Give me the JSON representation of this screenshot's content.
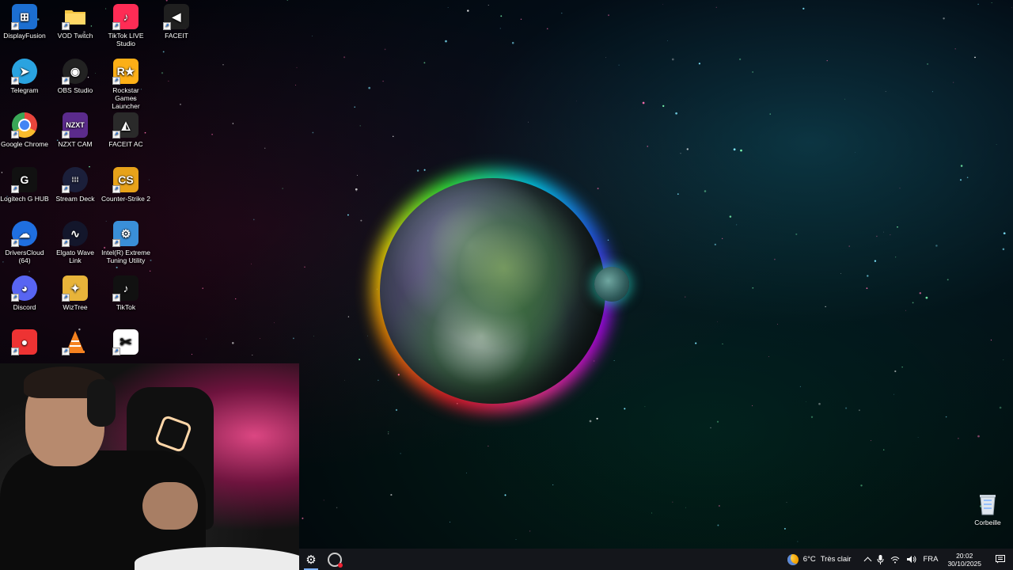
{
  "desktop": {
    "icons": [
      {
        "label": "DisplayFusion",
        "icon": "displayfusion-icon",
        "color": "#1c6fd1",
        "glyph": "⊞"
      },
      {
        "label": "VOD Twitch",
        "icon": "folder-icon",
        "color": "#f4c542",
        "glyph": ""
      },
      {
        "label": "TikTok LIVE Studio",
        "icon": "tiktok-live-studio-icon",
        "color": "#fe2c55",
        "glyph": "♪"
      },
      {
        "label": "FACEIT",
        "icon": "faceit-icon",
        "color": "#1f1f1f",
        "glyph": "◀"
      },
      {
        "label": "Telegram",
        "icon": "telegram-icon",
        "color": "#2aa3e0",
        "glyph": "➤"
      },
      {
        "label": "OBS Studio",
        "icon": "obs-studio-icon",
        "color": "#222222",
        "glyph": "◉"
      },
      {
        "label": "Rockstar Games Launcher",
        "icon": "rockstar-games-icon",
        "color": "#fcaf17",
        "glyph": "R★"
      },
      {
        "label": "Google Chrome",
        "icon": "chrome-icon",
        "color": "#e8453c",
        "glyph": "●"
      },
      {
        "label": "NZXT CAM",
        "icon": "nzxt-cam-icon",
        "color": "#5b2b8c",
        "glyph": "NZXT"
      },
      {
        "label": "FACEIT AC",
        "icon": "faceit-ac-icon",
        "color": "#2a2a2a",
        "glyph": "◭"
      },
      {
        "label": "Logitech G HUB",
        "icon": "logitech-ghub-icon",
        "color": "#111111",
        "glyph": "G"
      },
      {
        "label": "Stream Deck",
        "icon": "stream-deck-icon",
        "color": "#1b1f3a",
        "glyph": "⁞⁞⁞"
      },
      {
        "label": "Counter-Strike 2",
        "icon": "counter-strike-icon",
        "color": "#e7a21a",
        "glyph": "CS"
      },
      {
        "label": "DriversCloud (64)",
        "icon": "driverscloud-icon",
        "color": "#1f6fe0",
        "glyph": "☁"
      },
      {
        "label": "Elgato Wave Link",
        "icon": "wave-link-icon",
        "color": "#13162b",
        "glyph": "∿"
      },
      {
        "label": "Intel(R) Extreme Tuning Utility",
        "icon": "intel-xtu-icon",
        "color": "#3a8fd8",
        "glyph": "⚙"
      },
      {
        "label": "Discord",
        "icon": "discord-icon",
        "color": "#5865f2",
        "glyph": "◕"
      },
      {
        "label": "WizTree",
        "icon": "wiztree-icon",
        "color": "#e8b43a",
        "glyph": "✦"
      },
      {
        "label": "TikTok",
        "icon": "tiktok-icon",
        "color": "#111111",
        "glyph": "♪"
      },
      {
        "label": "",
        "icon": "partially-hidden-app-icon",
        "color": "#e33",
        "glyph": "●"
      },
      {
        "label": "",
        "icon": "vlc-icon",
        "color": "#f58220",
        "glyph": "▲"
      },
      {
        "label": "",
        "icon": "capcut-icon",
        "color": "#ffffff",
        "glyph": "✂"
      }
    ],
    "recycle_bin": {
      "label": "Corbeille",
      "icon": "recycle-bin-icon"
    }
  },
  "taskbar": {
    "apps": [
      {
        "name": "settings-icon",
        "glyph": "⚙",
        "active": true
      },
      {
        "name": "app-record-icon",
        "glyph": "◉",
        "active": false
      }
    ],
    "weather": {
      "temp": "6°C",
      "condition": "Très clair"
    },
    "tray": {
      "chevron": "^",
      "mic": "🎙",
      "network": "◠",
      "volume": "🔊",
      "language": "FRA"
    },
    "clock": {
      "time": "20:02",
      "date": "30/10/2025"
    },
    "notifications_glyph": "▤"
  },
  "colors": {
    "taskbar_bg": "#14161b",
    "accent": "#7fb3ff"
  }
}
